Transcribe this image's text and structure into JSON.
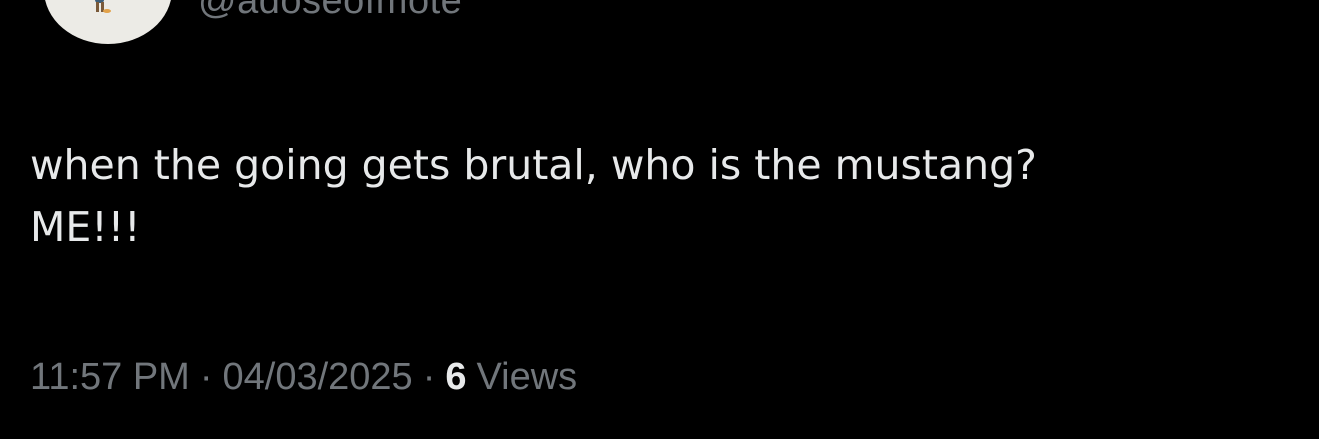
{
  "author": {
    "handle": "@adoseofmote"
  },
  "tweet": {
    "text": "when the going gets brutal, who is the mustang?\nME!!!"
  },
  "meta": {
    "time": "11:57 PM",
    "separator": "·",
    "date": "04/03/2025",
    "views_count": "6",
    "views_label": "Views"
  }
}
